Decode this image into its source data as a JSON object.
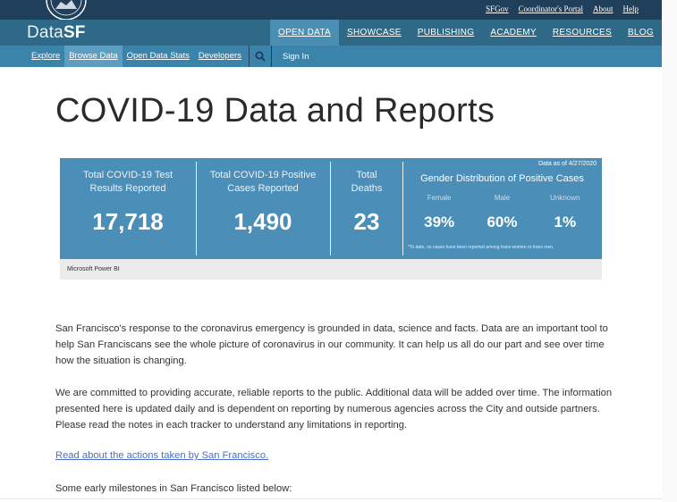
{
  "header": {
    "utility_links": [
      "SFGov",
      "Coordinator's Portal",
      "About",
      "Help"
    ],
    "logo_light": "Data",
    "logo_bold": "SF",
    "main_nav": [
      {
        "label": "OPEN DATA",
        "active": true
      },
      {
        "label": "SHOWCASE",
        "active": false
      },
      {
        "label": "PUBLISHING",
        "active": false
      },
      {
        "label": "ACADEMY",
        "active": false
      },
      {
        "label": "RESOURCES",
        "active": false
      },
      {
        "label": "BLOG",
        "active": false
      }
    ],
    "sub_nav": [
      {
        "label": "Explore",
        "active": false
      },
      {
        "label": "Browse Data",
        "active": true
      },
      {
        "label": "Open Data Stats",
        "active": false
      },
      {
        "label": "Developers",
        "active": false
      }
    ],
    "sign_in": "Sign In"
  },
  "page": {
    "title": "COVID-19 Data and Reports"
  },
  "dashboard": {
    "kpis": [
      {
        "label": "Total COVID-19 Test Results Reported",
        "value": "17,718"
      },
      {
        "label": "Total COVID-19 Positive Cases Reported",
        "value": "1,490"
      },
      {
        "label": "Total Deaths",
        "value": "23"
      }
    ],
    "gender": {
      "as_of": "Data as of 4/27/2020",
      "title": "Gender Distribution of Positive Cases",
      "columns": [
        {
          "name": "Female",
          "value": "39%"
        },
        {
          "name": "Male",
          "value": "60%"
        },
        {
          "name": "Unknown",
          "value": "1%"
        }
      ],
      "note": "*To date, no cases have been reported among trans women or trans men."
    },
    "footer": "Microsoft Power BI",
    "colors": {
      "panel": "#4b8eb7",
      "footer": "#ebebeb"
    }
  },
  "content": {
    "para1": "San Francisco's response to the coronavirus emergency is grounded in data, science and facts. Data are an important tool to help San Franciscans see the whole picture of coronavirus in our community. It can help us all do our part and see over time how the situation is changing.",
    "para2": "We are committed to providing accurate, reliable reports to the public. Additional data will be added over time. The information presented here is updated daily and is dependent on reporting by numerous agencies across the City and outside partners. Please read the notes in each tracker to understand any limitations in reporting.",
    "link": "Read about the actions taken by San Francisco.",
    "milestones": "Some early milestones in San Francisco listed below:"
  },
  "colors": {
    "topbar": "#1f3f5b",
    "mainbar": "#2e6a88",
    "subbar": "#3a84ab",
    "active_tab": "#4a8fb3",
    "link": "#4a6fc4"
  }
}
